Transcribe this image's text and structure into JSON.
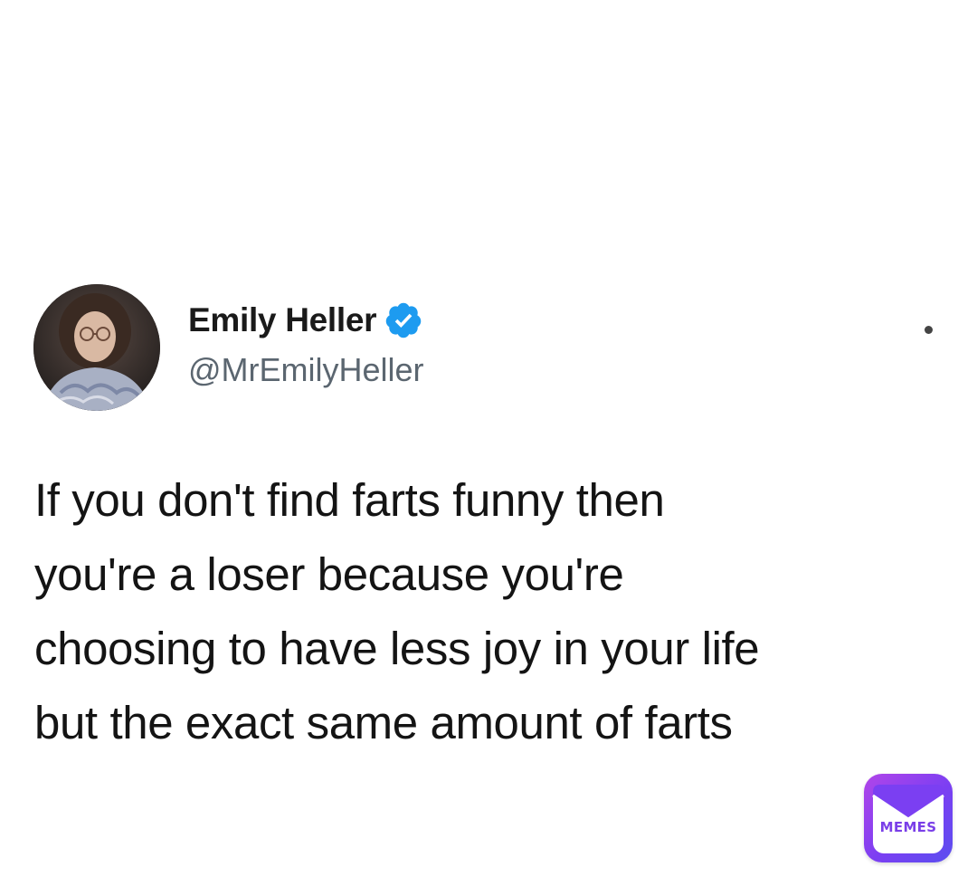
{
  "tweet": {
    "display_name": "Emily Heller",
    "handle": "@MrEmilyHeller",
    "verified": true,
    "text": "If you don't find farts funny then\nyou're a loser because you're\nchoosing to have less joy in your life\nbut the exact same amount of farts"
  },
  "avatar": {
    "icon": "profile-photo"
  },
  "watermark": {
    "label": "MEMES",
    "icon": "envelope-icon",
    "colors": {
      "gradient_start": "#b145e9",
      "gradient_end": "#5a4ef0",
      "text": "#7a3fe8"
    }
  },
  "colors": {
    "verified_badge": "#1d9bf0",
    "handle": "#5b6670",
    "text": "#141414"
  }
}
